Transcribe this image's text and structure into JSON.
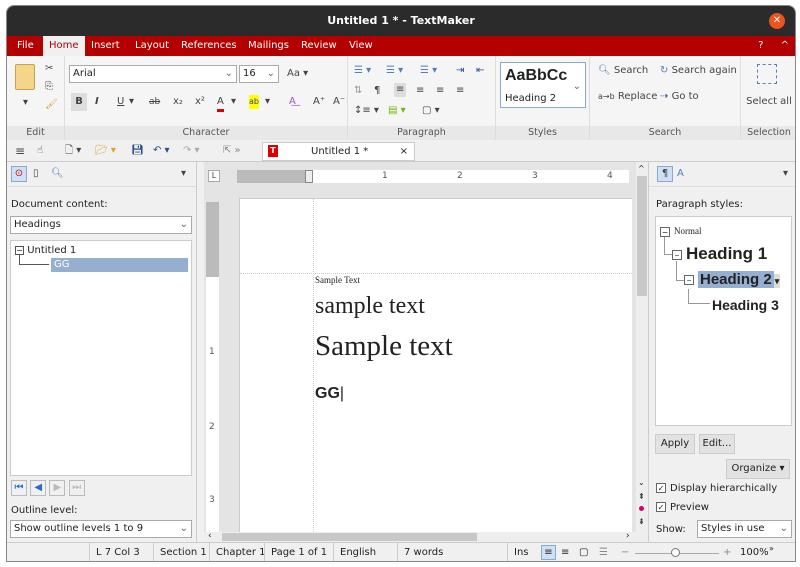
{
  "window": {
    "title": "Untitled 1 * - TextMaker"
  },
  "menu": {
    "tabs": [
      "File",
      "Home",
      "Insert",
      "Layout",
      "References",
      "Mailings",
      "Review",
      "View"
    ],
    "active": "Home",
    "help": "?",
    "collapse": "^"
  },
  "ribbon": {
    "edit": {
      "label": "Edit"
    },
    "character": {
      "label": "Character",
      "font": "Arial",
      "size": "16",
      "bold": "B",
      "italic": "I",
      "underline": "U",
      "strike": "ab",
      "subscript": "x₂",
      "superscript": "x²",
      "font_color": "A",
      "highlight": "ab",
      "grow": "A⁺",
      "shrink": "A⁻",
      "colors": {
        "font_color": "#e00000",
        "highlight": "#ffff00"
      }
    },
    "paragraph": {
      "label": "Paragraph"
    },
    "styles": {
      "label": "Styles",
      "preview": "AaBbCc",
      "current": "Heading 2"
    },
    "search": {
      "label": "Search",
      "search": "Search",
      "search_again": "Search again",
      "replace": "Replace",
      "goto": "Go to"
    },
    "selection": {
      "label": "Selection",
      "select_all": "Select all"
    }
  },
  "quickbar": {
    "doc_tab": "Untitled 1 *",
    "close": "×"
  },
  "left_panel": {
    "content_label": "Document content:",
    "content_select": "Headings",
    "tree": {
      "root": "Untitled 1",
      "children": [
        "GG"
      ]
    },
    "outline_label": "Outline level:",
    "outline_select": "Show outline levels 1 to 9"
  },
  "ruler": {
    "h_marks": [
      "1",
      "2",
      "3",
      "4"
    ],
    "v_marks": [
      "1",
      "2",
      "3"
    ]
  },
  "document": {
    "lines": [
      "Sample Text",
      "sample text",
      "Sample text",
      "GG"
    ]
  },
  "right_panel": {
    "label": "Paragraph styles:",
    "styles": [
      "Normal",
      "Heading 1",
      "Heading 2",
      "Heading 3"
    ],
    "selected": "Heading 2",
    "apply": "Apply",
    "edit": "Edit...",
    "organize": "Organize",
    "display_hier": "Display hierarchically",
    "preview": "Preview",
    "show_label": "Show:",
    "show_select": "Styles in use",
    "colors": {
      "selected_bg": "#94afd0"
    }
  },
  "status": {
    "pos": "L 7 Col 3",
    "section": "Section 1",
    "chapter": "Chapter 1",
    "page": "Page 1 of 1",
    "lang": "English",
    "words": "7 words",
    "mode": "Ins",
    "zoom": "100%",
    "zoom_level_percent": 100
  },
  "theme": {
    "accent": "#b30000",
    "titlebar": "#2b2b2b",
    "close": "#e95420"
  }
}
